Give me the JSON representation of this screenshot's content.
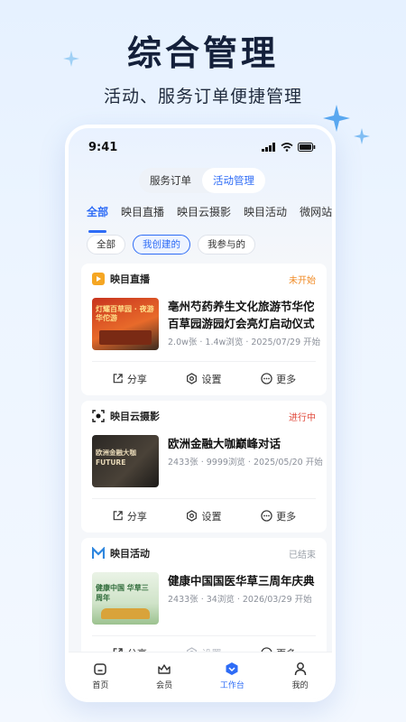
{
  "hero": {
    "title": "综合管理",
    "subtitle": "活动、服务订单便捷管理"
  },
  "status_bar": {
    "time": "9:41"
  },
  "segmented": {
    "items": [
      {
        "label": "服务订单",
        "active": false
      },
      {
        "label": "活动管理",
        "active": true
      }
    ]
  },
  "tabs": [
    {
      "label": "全部",
      "active": true
    },
    {
      "label": "映目直播",
      "active": false
    },
    {
      "label": "映目云摄影",
      "active": false
    },
    {
      "label": "映目活动",
      "active": false
    },
    {
      "label": "微网站",
      "active": false
    }
  ],
  "filters": [
    {
      "label": "全部",
      "active": false
    },
    {
      "label": "我创建的",
      "active": true
    },
    {
      "label": "我参与的",
      "active": false
    }
  ],
  "cards": [
    {
      "type_label": "映目直播",
      "type_icon": "live-icon",
      "status": "未开始",
      "status_color": "#f08a24",
      "title": "亳州芍药养生文化旅游节华佗百草园游园灯会亮灯启动仪式",
      "meta": "2.0w张 · 1.4w浏览 · 2025/07/29 开始",
      "thumb_text": "灯耀百草园 · 夜游华佗游",
      "actions": [
        {
          "label": "分享",
          "icon": "share-icon",
          "disabled": false
        },
        {
          "label": "设置",
          "icon": "settings-icon",
          "disabled": false
        },
        {
          "label": "更多",
          "icon": "more-icon",
          "disabled": false
        }
      ]
    },
    {
      "type_label": "映目云摄影",
      "type_icon": "camera-icon",
      "status": "进行中",
      "status_color": "#e0483a",
      "title": "欧洲金融大咖巅峰对话",
      "meta": "2433张 · 9999浏览 · 2025/05/20 开始",
      "thumb_text": "欧洲金融大咖 FUTURE",
      "actions": [
        {
          "label": "分享",
          "icon": "share-icon",
          "disabled": false
        },
        {
          "label": "设置",
          "icon": "settings-icon",
          "disabled": false
        },
        {
          "label": "更多",
          "icon": "more-icon",
          "disabled": false
        }
      ]
    },
    {
      "type_label": "映目活动",
      "type_icon": "activity-icon",
      "status": "已结束",
      "status_color": "#9aa0a8",
      "title": "健康中国国医华草三周年庆典",
      "meta": "2433张 · 34浏览 · 2026/03/29 开始",
      "thumb_text": "健康中国 华草三周年",
      "actions": [
        {
          "label": "分享",
          "icon": "share-icon",
          "disabled": false
        },
        {
          "label": "设置",
          "icon": "settings-icon",
          "disabled": true
        },
        {
          "label": "更多",
          "icon": "more-icon",
          "disabled": false
        }
      ]
    }
  ],
  "bottom_nav": [
    {
      "label": "首页",
      "icon": "home-icon",
      "active": false
    },
    {
      "label": "会员",
      "icon": "member-icon",
      "active": false
    },
    {
      "label": "工作台",
      "icon": "workbench-icon",
      "active": true
    },
    {
      "label": "我的",
      "icon": "profile-icon",
      "active": false
    }
  ],
  "colors": {
    "accent": "#2e6cf6",
    "status_not_started": "#f08a24",
    "status_in_progress": "#e0483a",
    "status_ended": "#9aa0a8"
  }
}
